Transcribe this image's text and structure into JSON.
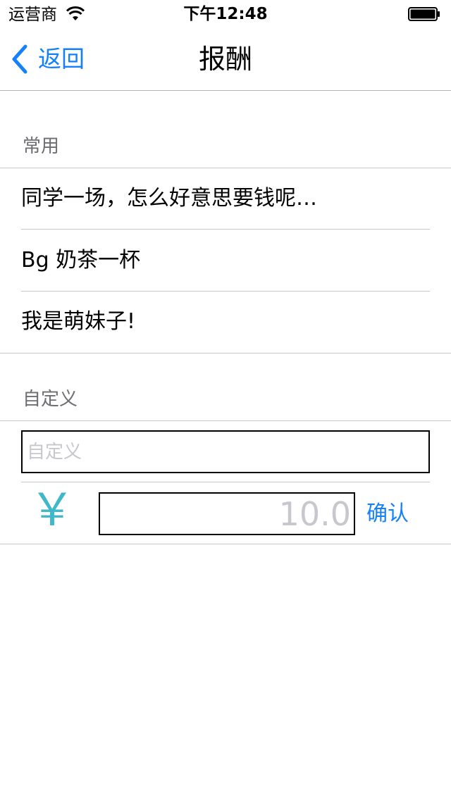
{
  "status_bar": {
    "carrier": "运营商",
    "time": "下午12:48",
    "wifi_icon": "wifi-icon",
    "battery_icon": "battery-full-icon",
    "battery_level": 1.0
  },
  "nav": {
    "back_label": "返回",
    "back_icon": "chevron-left-icon",
    "title": "报酬"
  },
  "sections": {
    "common": {
      "header": "常用",
      "items": [
        {
          "label": "同学一场，怎么好意思要钱呢…"
        },
        {
          "label": "Bg 奶茶一杯"
        },
        {
          "label": "我是萌妹子!"
        }
      ]
    },
    "custom": {
      "header": "自定义",
      "input_placeholder": "自定义",
      "input_value": "",
      "currency_symbol": "￥",
      "amount_placeholder": "10.0",
      "amount_value": "",
      "confirm_label": "确认"
    }
  },
  "colors": {
    "accent": "#1580fb",
    "currency": "#3fb8c9",
    "section_header": "#6d6d72",
    "separator": "#c8c7cc",
    "placeholder": "#c7c7cd"
  }
}
